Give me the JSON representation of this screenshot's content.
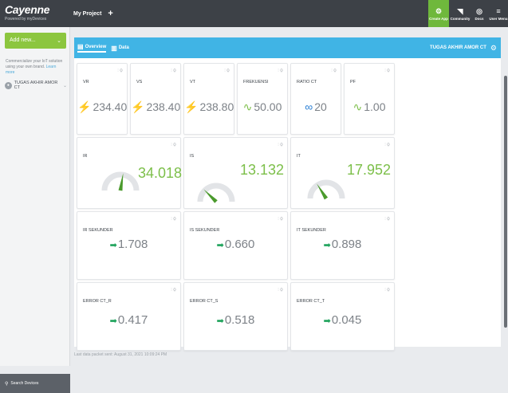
{
  "topbar": {
    "logo_name": "Cayenne",
    "logo_sub": "Powered by myDevices",
    "project": "My Project",
    "add_label": "+",
    "items": [
      {
        "label": "Create App",
        "icon": "create-app-icon"
      },
      {
        "label": "Community",
        "icon": "megaphone-icon"
      },
      {
        "label": "Docs",
        "icon": "docs-icon"
      },
      {
        "label": "User Menu",
        "icon": "menu-icon"
      }
    ]
  },
  "sidebar": {
    "add_new": "Add new...",
    "add_chevron": "⌄",
    "promo_text": "Commercialize your IoT solution using your own brand.",
    "promo_link": "Learn more",
    "device_name": "TUGAS AKHIR AMOR CT",
    "search_label": "Search Devices"
  },
  "tabs": {
    "overview": "Overview",
    "data": "Data",
    "device_title": "TUGAS AKHIR AMOR CT"
  },
  "widgets": {
    "vr": {
      "label": "VR",
      "value": "234.40"
    },
    "vs": {
      "label": "VS",
      "value": "238.40"
    },
    "vt": {
      "label": "VT",
      "value": "238.80"
    },
    "frek": {
      "label": "FREKUENSI",
      "value": "50.00"
    },
    "ratio": {
      "label": "RATIO CT",
      "value": "20"
    },
    "pf": {
      "label": "PF",
      "value": "1.00"
    },
    "ir": {
      "label": "IR",
      "value": "34.018",
      "level": 0.55
    },
    "is": {
      "label": "IS",
      "value": "13.132",
      "level": 0.25
    },
    "it": {
      "label": "IT",
      "value": "17.952",
      "level": 0.32
    },
    "irsek": {
      "label": "IR SEKUNDER",
      "value": "1.708"
    },
    "issek": {
      "label": "IS SEKUNDER",
      "value": "0.660"
    },
    "itsek": {
      "label": "IT SEKUNDER",
      "value": "0.898"
    },
    "errr": {
      "label": "ERROR CT_R",
      "value": "0.417"
    },
    "errs": {
      "label": "ERROR CT_S",
      "value": "0.518"
    },
    "errt": {
      "label": "ERROR CT_T",
      "value": "0.045"
    }
  },
  "tools_label": "⫶ ⚙",
  "footer": "Last data packet sent: August 31, 2021 10:09:24 PM",
  "colors": {
    "accent": "#40b4e5",
    "green": "#8cc63f",
    "bolt": "#f4b400",
    "gaugeNeedle": "#4a9a2c"
  }
}
